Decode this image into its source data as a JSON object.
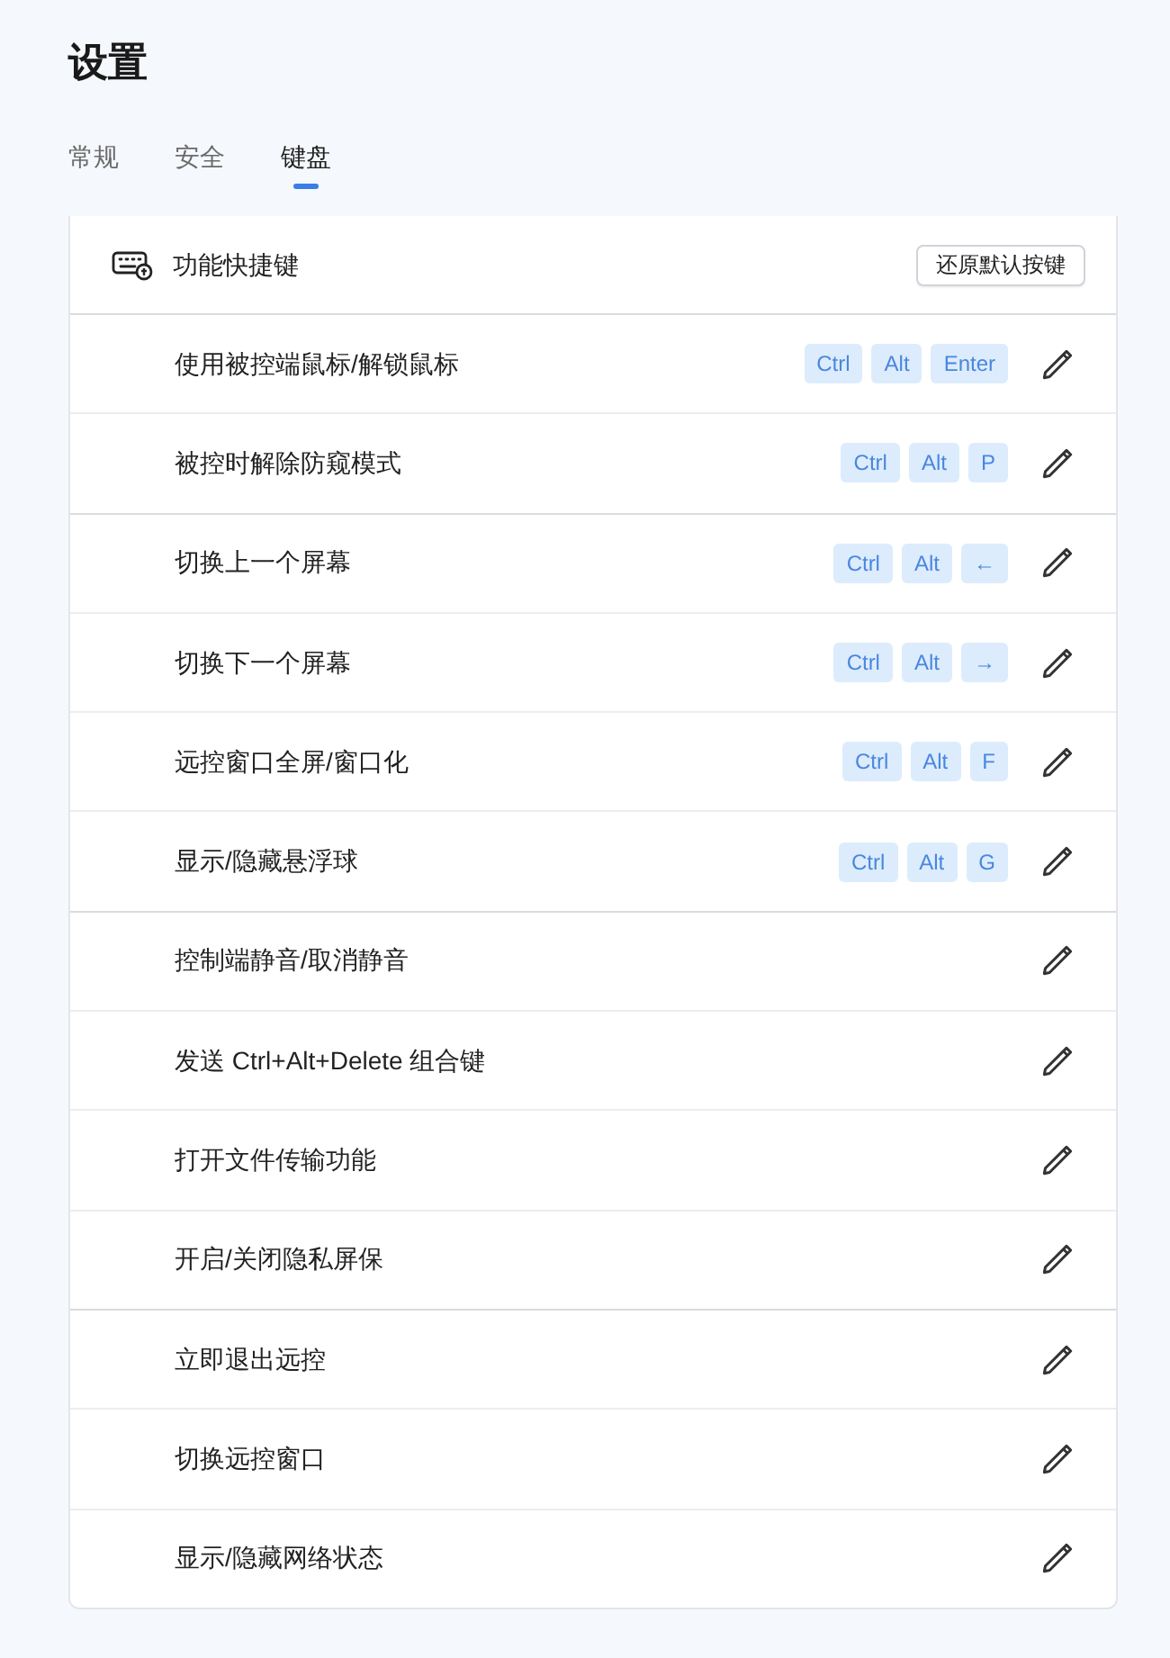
{
  "page": {
    "title": "设置"
  },
  "tabs": [
    {
      "label": "常规",
      "selected": false
    },
    {
      "label": "安全",
      "selected": false
    },
    {
      "label": "键盘",
      "selected": true
    }
  ],
  "shortcuts_panel": {
    "title": "功能快捷键",
    "reset_button": "还原默认按键",
    "groups": [
      {
        "items": [
          {
            "label": "使用被控端鼠标/解锁鼠标",
            "keys": [
              "Ctrl",
              "Alt",
              "Enter"
            ]
          },
          {
            "label": "被控时解除防窥模式",
            "keys": [
              "Ctrl",
              "Alt",
              "P"
            ]
          }
        ]
      },
      {
        "items": [
          {
            "label": "切换上一个屏幕",
            "keys": [
              "Ctrl",
              "Alt",
              "←"
            ]
          },
          {
            "label": "切换下一个屏幕",
            "keys": [
              "Ctrl",
              "Alt",
              "→"
            ]
          },
          {
            "label": "远控窗口全屏/窗口化",
            "keys": [
              "Ctrl",
              "Alt",
              "F"
            ]
          },
          {
            "label": "显示/隐藏悬浮球",
            "keys": [
              "Ctrl",
              "Alt",
              "G"
            ]
          }
        ]
      },
      {
        "items": [
          {
            "label": "控制端静音/取消静音"
          },
          {
            "label": "发送 Ctrl+Alt+Delete 组合键"
          },
          {
            "label": "打开文件传输功能"
          },
          {
            "label": "开启/关闭隐私屏保"
          }
        ]
      },
      {
        "items": [
          {
            "label": "立即退出远控"
          },
          {
            "label": "切换远控窗口"
          },
          {
            "label": "显示/隐藏网络状态"
          }
        ]
      }
    ]
  }
}
